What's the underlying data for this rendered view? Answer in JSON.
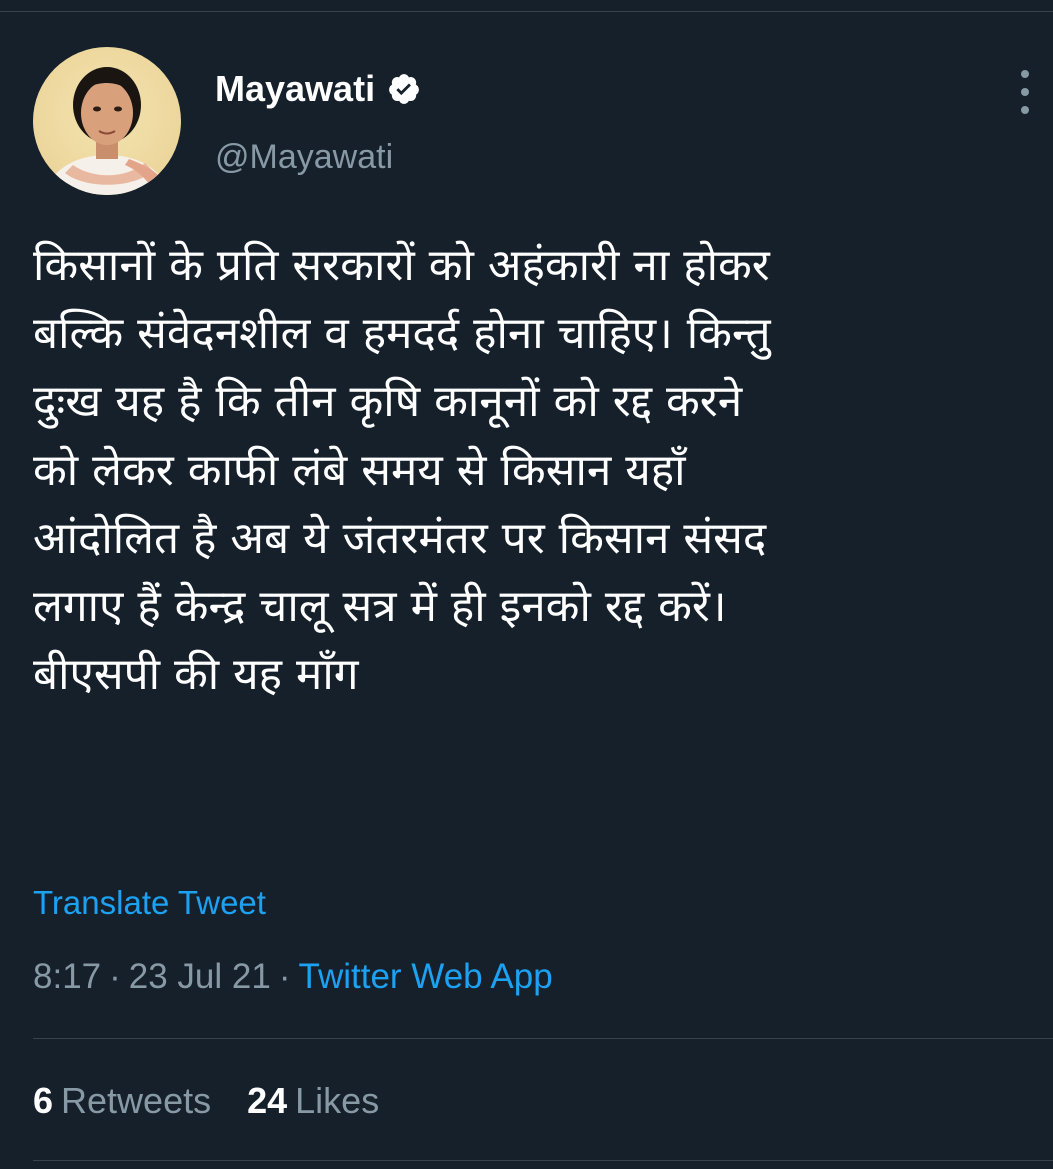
{
  "theme": {
    "background": "#15202b",
    "text": "#ffffff",
    "secondary_text": "#8899a6",
    "accent": "#1da1f2",
    "divider": "#38444d"
  },
  "author": {
    "display_name": "Mayawati",
    "handle": "@Mayawati",
    "verified": true,
    "avatar_icon": "profile-photo",
    "more_icon": "more-vertical-icon"
  },
  "tweet": {
    "text_lines": [
      "किसानों के प्रति सरकारों को अहंकारी ना होकर",
      "बल्कि संवेदनशील व हमदर्द होना चाहिए। किन्तु",
      "दुःख यह है कि तीन कृषि कानूनों को रद्द करने",
      "को लेकर काफी लंबे समय से किसान यहाँ",
      "आंदोलित है अब ये जंतरमंतर पर किसान संसद",
      "लगाए हैं केन्द्र चालू सत्र में ही इनको रद्द करें।",
      "बीएसपी की यह माँग"
    ],
    "translate_label": "Translate Tweet",
    "time": "8:17",
    "date": "23 Jul 21",
    "separator": "·",
    "source": "Twitter Web App"
  },
  "stats": {
    "retweets_count": "6",
    "retweets_label": "Retweets",
    "likes_count": "24",
    "likes_label": "Likes"
  }
}
